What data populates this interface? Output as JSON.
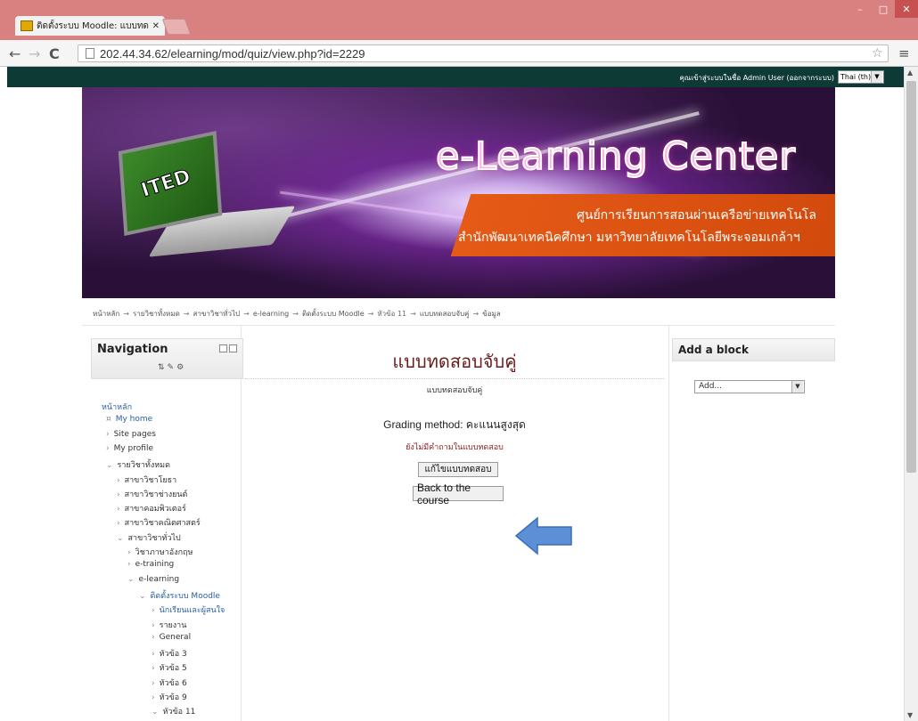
{
  "browser": {
    "tab_title": "ติดตั้งระบบ Moodle: แบบทด",
    "url": "202.44.34.62/elearning/mod/quiz/view.php?id=2229"
  },
  "admin_bar": {
    "login_text": "คุณเข้าสู่ระบบในชื่อ Admin User (ออกจากระบบ)",
    "language": "Thai (th)"
  },
  "banner": {
    "logo_text": "ITED",
    "title": "e-Learning Center",
    "line1": "ศูนย์การเรียนการสอนผ่านเครือข่ายเทคโนโล",
    "line2": "สำนักพัฒนาเทคนิคศึกษา มหาวิทยาลัยเทคโนโลยีพระจอมเกล้าฯ"
  },
  "breadcrumb": [
    "หน้าหลัก",
    "รายวิชาทั้งหมด",
    "สาขาวิชาทั่วไป",
    "e-learning",
    "ติดตั้งระบบ Moodle",
    "หัวข้อ 11",
    "แบบทดสอบจับคู่",
    "ข้อมูล"
  ],
  "navigation": {
    "title": "Navigation",
    "items": [
      {
        "label": "หน้าหลัก",
        "arrow": "",
        "link": true
      },
      {
        "label": "My home",
        "arrow": "¤",
        "link": true
      },
      {
        "label": "Site pages",
        "arrow": "›",
        "link": false
      },
      {
        "label": "My profile",
        "arrow": "›",
        "link": false
      },
      {
        "label": "รายวิชาทั้งหมด",
        "arrow": "⌄",
        "link": false
      },
      {
        "label": "สาขาวิชาโยธา",
        "arrow": "›",
        "link": false
      },
      {
        "label": "สาขาวิชาช่างยนต์",
        "arrow": "›",
        "link": false
      },
      {
        "label": "สาขาคอมพิวเตอร์",
        "arrow": "›",
        "link": false
      },
      {
        "label": "สาขาวิชาคณิตศาสตร์",
        "arrow": "›",
        "link": false
      },
      {
        "label": "สาขาวิชาทั่วไป",
        "arrow": "⌄",
        "link": false
      },
      {
        "label": "วิชาภาษาอังกฤษ",
        "arrow": "›",
        "link": false
      },
      {
        "label": "e-training",
        "arrow": "›",
        "link": false
      },
      {
        "label": "e-learning",
        "arrow": "⌄",
        "link": false
      },
      {
        "label": "ติดตั้งระบบ Moodle",
        "arrow": "⌄",
        "link": true
      },
      {
        "label": "นักเรียนและผู้สนใจ",
        "arrow": "›",
        "link": true
      },
      {
        "label": "รายงาน",
        "arrow": "›",
        "link": false
      },
      {
        "label": "General",
        "arrow": "›",
        "link": false
      },
      {
        "label": "หัวข้อ 3",
        "arrow": "›",
        "link": false
      },
      {
        "label": "หัวข้อ 5",
        "arrow": "›",
        "link": false
      },
      {
        "label": "หัวข้อ 6",
        "arrow": "›",
        "link": false
      },
      {
        "label": "หัวข้อ 9",
        "arrow": "›",
        "link": false
      },
      {
        "label": "หัวข้อ 11",
        "arrow": "⌄",
        "link": false
      }
    ]
  },
  "main": {
    "heading": "แบบทดสอบจับคู่",
    "intro": "แบบทดสอบจับคู่",
    "grading": "Grading method: คะแนนสูงสุด",
    "no_questions": "ยังไม่มีคำถามในแบบทดสอบ",
    "edit_button": "แก้ไขแบบทดสอบ",
    "back_button": "Back to the course"
  },
  "add_block": {
    "title": "Add a block",
    "select_value": "Add..."
  },
  "colors": {
    "admin_bar": "#0e3a35",
    "heading": "#6a1a1a",
    "link": "#2a5d9f",
    "annotation_arrow": "#5b8fd6"
  }
}
